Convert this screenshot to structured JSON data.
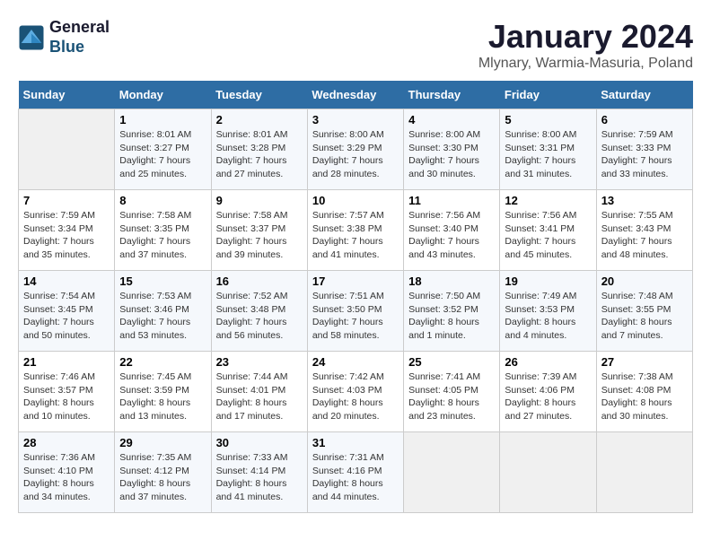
{
  "logo": {
    "general": "General",
    "blue": "Blue"
  },
  "title": "January 2024",
  "location": "Mlynary, Warmia-Masuria, Poland",
  "days_of_week": [
    "Sunday",
    "Monday",
    "Tuesday",
    "Wednesday",
    "Thursday",
    "Friday",
    "Saturday"
  ],
  "weeks": [
    [
      {
        "day": "",
        "info": ""
      },
      {
        "day": "1",
        "info": "Sunrise: 8:01 AM\nSunset: 3:27 PM\nDaylight: 7 hours\nand 25 minutes."
      },
      {
        "day": "2",
        "info": "Sunrise: 8:01 AM\nSunset: 3:28 PM\nDaylight: 7 hours\nand 27 minutes."
      },
      {
        "day": "3",
        "info": "Sunrise: 8:00 AM\nSunset: 3:29 PM\nDaylight: 7 hours\nand 28 minutes."
      },
      {
        "day": "4",
        "info": "Sunrise: 8:00 AM\nSunset: 3:30 PM\nDaylight: 7 hours\nand 30 minutes."
      },
      {
        "day": "5",
        "info": "Sunrise: 8:00 AM\nSunset: 3:31 PM\nDaylight: 7 hours\nand 31 minutes."
      },
      {
        "day": "6",
        "info": "Sunrise: 7:59 AM\nSunset: 3:33 PM\nDaylight: 7 hours\nand 33 minutes."
      }
    ],
    [
      {
        "day": "7",
        "info": "Sunrise: 7:59 AM\nSunset: 3:34 PM\nDaylight: 7 hours\nand 35 minutes."
      },
      {
        "day": "8",
        "info": "Sunrise: 7:58 AM\nSunset: 3:35 PM\nDaylight: 7 hours\nand 37 minutes."
      },
      {
        "day": "9",
        "info": "Sunrise: 7:58 AM\nSunset: 3:37 PM\nDaylight: 7 hours\nand 39 minutes."
      },
      {
        "day": "10",
        "info": "Sunrise: 7:57 AM\nSunset: 3:38 PM\nDaylight: 7 hours\nand 41 minutes."
      },
      {
        "day": "11",
        "info": "Sunrise: 7:56 AM\nSunset: 3:40 PM\nDaylight: 7 hours\nand 43 minutes."
      },
      {
        "day": "12",
        "info": "Sunrise: 7:56 AM\nSunset: 3:41 PM\nDaylight: 7 hours\nand 45 minutes."
      },
      {
        "day": "13",
        "info": "Sunrise: 7:55 AM\nSunset: 3:43 PM\nDaylight: 7 hours\nand 48 minutes."
      }
    ],
    [
      {
        "day": "14",
        "info": "Sunrise: 7:54 AM\nSunset: 3:45 PM\nDaylight: 7 hours\nand 50 minutes."
      },
      {
        "day": "15",
        "info": "Sunrise: 7:53 AM\nSunset: 3:46 PM\nDaylight: 7 hours\nand 53 minutes."
      },
      {
        "day": "16",
        "info": "Sunrise: 7:52 AM\nSunset: 3:48 PM\nDaylight: 7 hours\nand 56 minutes."
      },
      {
        "day": "17",
        "info": "Sunrise: 7:51 AM\nSunset: 3:50 PM\nDaylight: 7 hours\nand 58 minutes."
      },
      {
        "day": "18",
        "info": "Sunrise: 7:50 AM\nSunset: 3:52 PM\nDaylight: 8 hours\nand 1 minute."
      },
      {
        "day": "19",
        "info": "Sunrise: 7:49 AM\nSunset: 3:53 PM\nDaylight: 8 hours\nand 4 minutes."
      },
      {
        "day": "20",
        "info": "Sunrise: 7:48 AM\nSunset: 3:55 PM\nDaylight: 8 hours\nand 7 minutes."
      }
    ],
    [
      {
        "day": "21",
        "info": "Sunrise: 7:46 AM\nSunset: 3:57 PM\nDaylight: 8 hours\nand 10 minutes."
      },
      {
        "day": "22",
        "info": "Sunrise: 7:45 AM\nSunset: 3:59 PM\nDaylight: 8 hours\nand 13 minutes."
      },
      {
        "day": "23",
        "info": "Sunrise: 7:44 AM\nSunset: 4:01 PM\nDaylight: 8 hours\nand 17 minutes."
      },
      {
        "day": "24",
        "info": "Sunrise: 7:42 AM\nSunset: 4:03 PM\nDaylight: 8 hours\nand 20 minutes."
      },
      {
        "day": "25",
        "info": "Sunrise: 7:41 AM\nSunset: 4:05 PM\nDaylight: 8 hours\nand 23 minutes."
      },
      {
        "day": "26",
        "info": "Sunrise: 7:39 AM\nSunset: 4:06 PM\nDaylight: 8 hours\nand 27 minutes."
      },
      {
        "day": "27",
        "info": "Sunrise: 7:38 AM\nSunset: 4:08 PM\nDaylight: 8 hours\nand 30 minutes."
      }
    ],
    [
      {
        "day": "28",
        "info": "Sunrise: 7:36 AM\nSunset: 4:10 PM\nDaylight: 8 hours\nand 34 minutes."
      },
      {
        "day": "29",
        "info": "Sunrise: 7:35 AM\nSunset: 4:12 PM\nDaylight: 8 hours\nand 37 minutes."
      },
      {
        "day": "30",
        "info": "Sunrise: 7:33 AM\nSunset: 4:14 PM\nDaylight: 8 hours\nand 41 minutes."
      },
      {
        "day": "31",
        "info": "Sunrise: 7:31 AM\nSunset: 4:16 PM\nDaylight: 8 hours\nand 44 minutes."
      },
      {
        "day": "",
        "info": ""
      },
      {
        "day": "",
        "info": ""
      },
      {
        "day": "",
        "info": ""
      }
    ]
  ]
}
